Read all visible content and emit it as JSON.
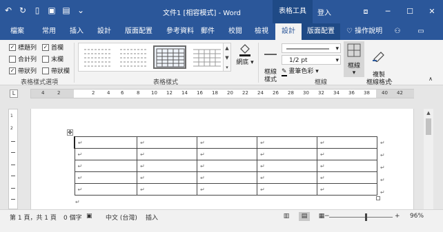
{
  "titlebar": {
    "doc_title": "文件1 [相容模式] - Word",
    "context_label": "表格工具",
    "signin": "登入",
    "qat": [
      "undo-icon",
      "redo-icon",
      "new-doc-icon",
      "save-icon",
      "print-icon",
      "customize-icon"
    ],
    "window_controls": {
      "restore_ribbon": "⧈",
      "minimize": "─",
      "maximize": "☐",
      "close": "✕"
    }
  },
  "tabs": [
    "檔案",
    "常用",
    "插入",
    "設計",
    "版面配置",
    "參考資料",
    "郵件",
    "校閱",
    "檢視",
    "設計",
    "版面配置"
  ],
  "tab_tell_me": "操作說明",
  "active_tab_index": 9,
  "ribbon": {
    "style_options": {
      "label": "表格樣式選項",
      "items": [
        {
          "label": "標題列",
          "checked": true
        },
        {
          "label": "首欄",
          "checked": true
        },
        {
          "label": "合計列",
          "checked": false
        },
        {
          "label": "末欄",
          "checked": false
        },
        {
          "label": "帶狀列",
          "checked": true
        },
        {
          "label": "帶狀欄",
          "checked": false
        }
      ]
    },
    "table_styles": {
      "label": "表格樣式",
      "selected_index": 2
    },
    "shading": {
      "label": "網底"
    },
    "borders": {
      "label": "框線",
      "border_styles_label": "框線\n樣式",
      "line_weight": "1/2 pt",
      "pen_color": "畫筆色彩",
      "borders_button": "框線",
      "painter": "複製\n框線格式"
    }
  },
  "ruler": {
    "numbers": [
      "4",
      "2",
      "2",
      "4",
      "6",
      "8",
      "10",
      "12",
      "14",
      "16",
      "18",
      "20",
      "22",
      "24",
      "26",
      "28",
      "30",
      "32",
      "34",
      "36",
      "38",
      "40",
      "42"
    ],
    "vertical_numbers": [
      "1",
      "2",
      "1",
      "1",
      "2",
      "3",
      "4",
      "5"
    ]
  },
  "document": {
    "rows": 5,
    "cols": 5,
    "cell_mark": "↵"
  },
  "statusbar": {
    "page": "第 1 頁，共 1 頁",
    "words": "0 個字",
    "language": "中文 (台灣)",
    "mode": "插入",
    "zoom": "96%",
    "zoom_minus": "−",
    "zoom_plus": "+"
  }
}
